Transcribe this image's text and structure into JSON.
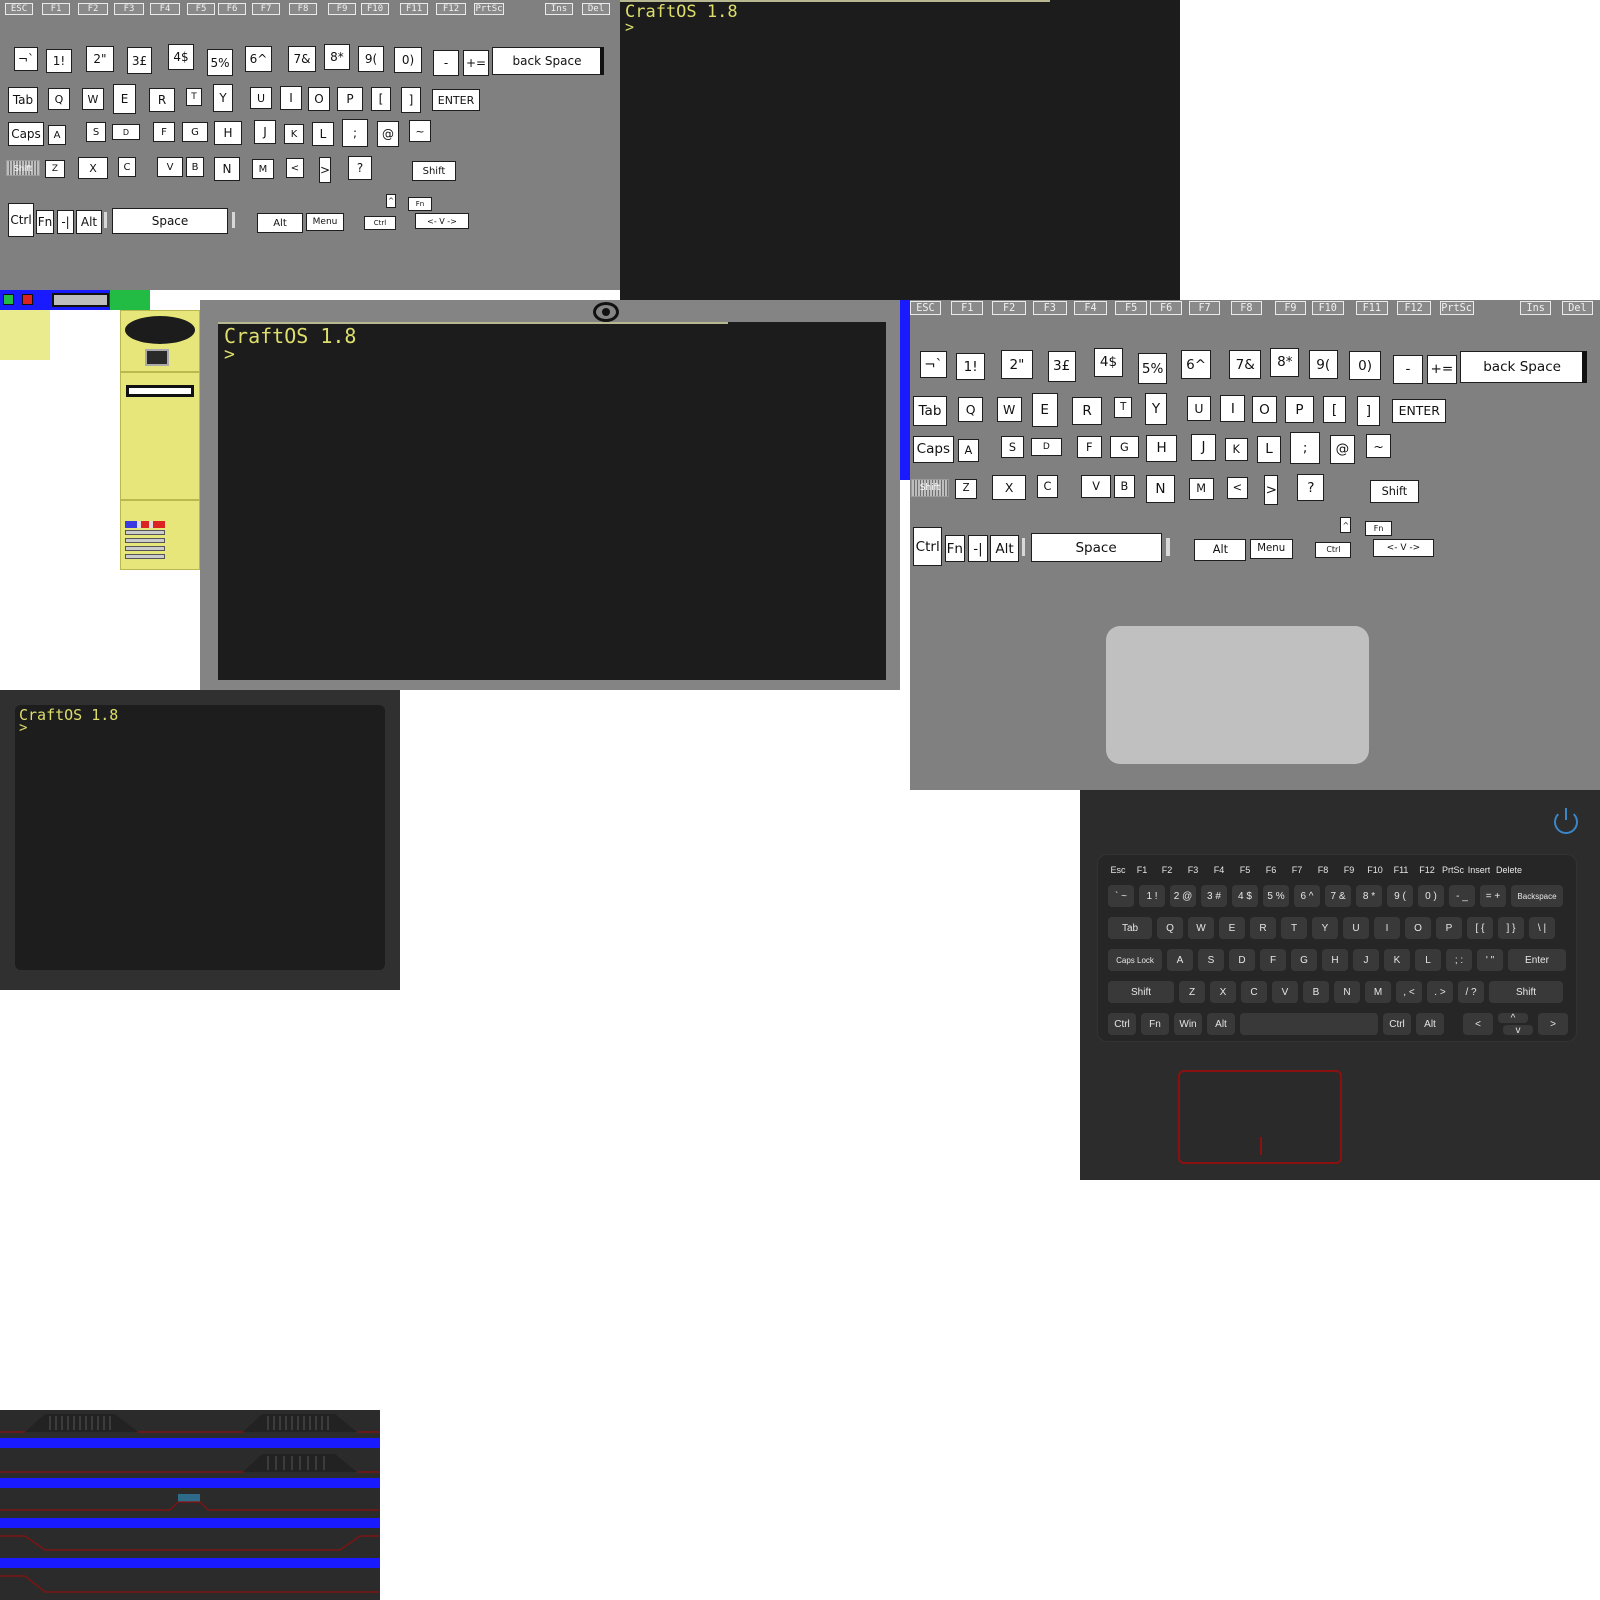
{
  "keyboard_small": {
    "fkeys": [
      "ESC",
      "F1",
      "F2",
      "F3",
      "F4",
      "F5",
      "F6",
      "F7",
      "F8",
      "F9",
      "F10",
      "F11",
      "F12",
      "PrtSc",
      "Ins",
      "Del"
    ],
    "rows": [
      [
        "¬`",
        "1!",
        "2\"",
        "3£",
        "4$",
        "5%",
        "6^",
        "7&",
        "8*",
        "9(",
        "0)",
        "-",
        "+=",
        "back Space"
      ],
      [
        "Tab",
        "Q",
        "W",
        "E",
        "R",
        "T",
        "Y",
        "U",
        "I",
        "O",
        "P",
        "[",
        "]",
        "ENTER"
      ],
      [
        "Caps",
        "A",
        "S",
        "D",
        "F",
        "G",
        "H",
        "J",
        "K",
        "L",
        ";",
        "@",
        "~"
      ],
      [
        "Shift",
        "Z",
        "X",
        "C",
        "V",
        "B",
        "N",
        "M",
        "<",
        ">",
        "?",
        "Shift"
      ],
      [
        "Ctrl",
        "Fn",
        "-|",
        "Alt",
        "Space",
        "Alt",
        "Menu",
        "Ctrl",
        "^",
        "Fn",
        "<- V ->"
      ]
    ]
  },
  "keyboard_large": {
    "fkeys": [
      "ESC",
      "F1",
      "F2",
      "F3",
      "F4",
      "F5",
      "F6",
      "F7",
      "F8",
      "F9",
      "F10",
      "F11",
      "F12",
      "PrtSc",
      "Ins",
      "Del"
    ],
    "rows": [
      [
        "¬`",
        "1!",
        "2\"",
        "3£",
        "4$",
        "5%",
        "6^",
        "7&",
        "8*",
        "9(",
        "0)",
        "-",
        "+=",
        "back Space"
      ],
      [
        "Tab",
        "Q",
        "W",
        "E",
        "R",
        "T",
        "Y",
        "U",
        "I",
        "O",
        "P",
        "[",
        "]",
        "ENTER"
      ],
      [
        "Caps",
        "A",
        "S",
        "D",
        "F",
        "G",
        "H",
        "J",
        "K",
        "L",
        ";",
        "@",
        "~"
      ],
      [
        "Shift",
        "Z",
        "X",
        "C",
        "V",
        "B",
        "N",
        "M",
        "<",
        ">",
        "?",
        "Shift"
      ],
      [
        "Ctrl",
        "Fn",
        "-|",
        "Alt",
        "Space",
        "Alt",
        "Menu",
        "Ctrl",
        "^",
        "Fn",
        "<- V ->"
      ]
    ]
  },
  "terminal_top": {
    "title": "CraftOS 1.8",
    "prompt": ">"
  },
  "terminal_main": {
    "title": "CraftOS 1.8",
    "prompt": ">"
  },
  "terminal_small": {
    "title": "CraftOS 1.8",
    "prompt": ">"
  },
  "keyboard_dark": {
    "rows": [
      [
        "Esc",
        "F1",
        "F2",
        "F3",
        "F4",
        "F5",
        "F6",
        "F7",
        "F8",
        "F9",
        "F10",
        "F11",
        "F12",
        "PrtSc",
        "Insert",
        "Delete"
      ],
      [
        "` ~",
        "1 !",
        "2 @",
        "3 #",
        "4 $",
        "5 %",
        "6 ^",
        "7 &",
        "8 *",
        "9 (",
        "0 )",
        "- _",
        "= +",
        "Backspace"
      ],
      [
        "Tab",
        "Q",
        "W",
        "E",
        "R",
        "T",
        "Y",
        "U",
        "I",
        "O",
        "P",
        "[ {",
        "] }",
        "\\ |"
      ],
      [
        "Caps Lock",
        "A",
        "S",
        "D",
        "F",
        "G",
        "H",
        "J",
        "K",
        "L",
        ";  :",
        "'  \"",
        "Enter"
      ],
      [
        "Shift",
        "Z",
        "X",
        "C",
        "V",
        "B",
        "N",
        "M",
        ", <",
        ". >",
        "/ ?",
        "Shift"
      ],
      [
        "Ctrl",
        "Fn",
        "Win",
        "Alt",
        "",
        "Ctrl",
        "Alt",
        "<",
        "^",
        "v",
        ">"
      ]
    ]
  },
  "colors": {
    "panel_gray": "#808080",
    "terminal_bg": "#1c1c1c",
    "terminal_text": "#dede6c",
    "accent_blue": "#1a1aff",
    "accent_green": "#22bb44",
    "accent_red": "#dd2222",
    "sidebar_yellow": "#e6e67a",
    "power_blue": "#3a86c8",
    "trackpad_red": "#8b1010"
  },
  "icons": [
    "power-icon",
    "eye-icon",
    "speaker-grille-icon"
  ]
}
